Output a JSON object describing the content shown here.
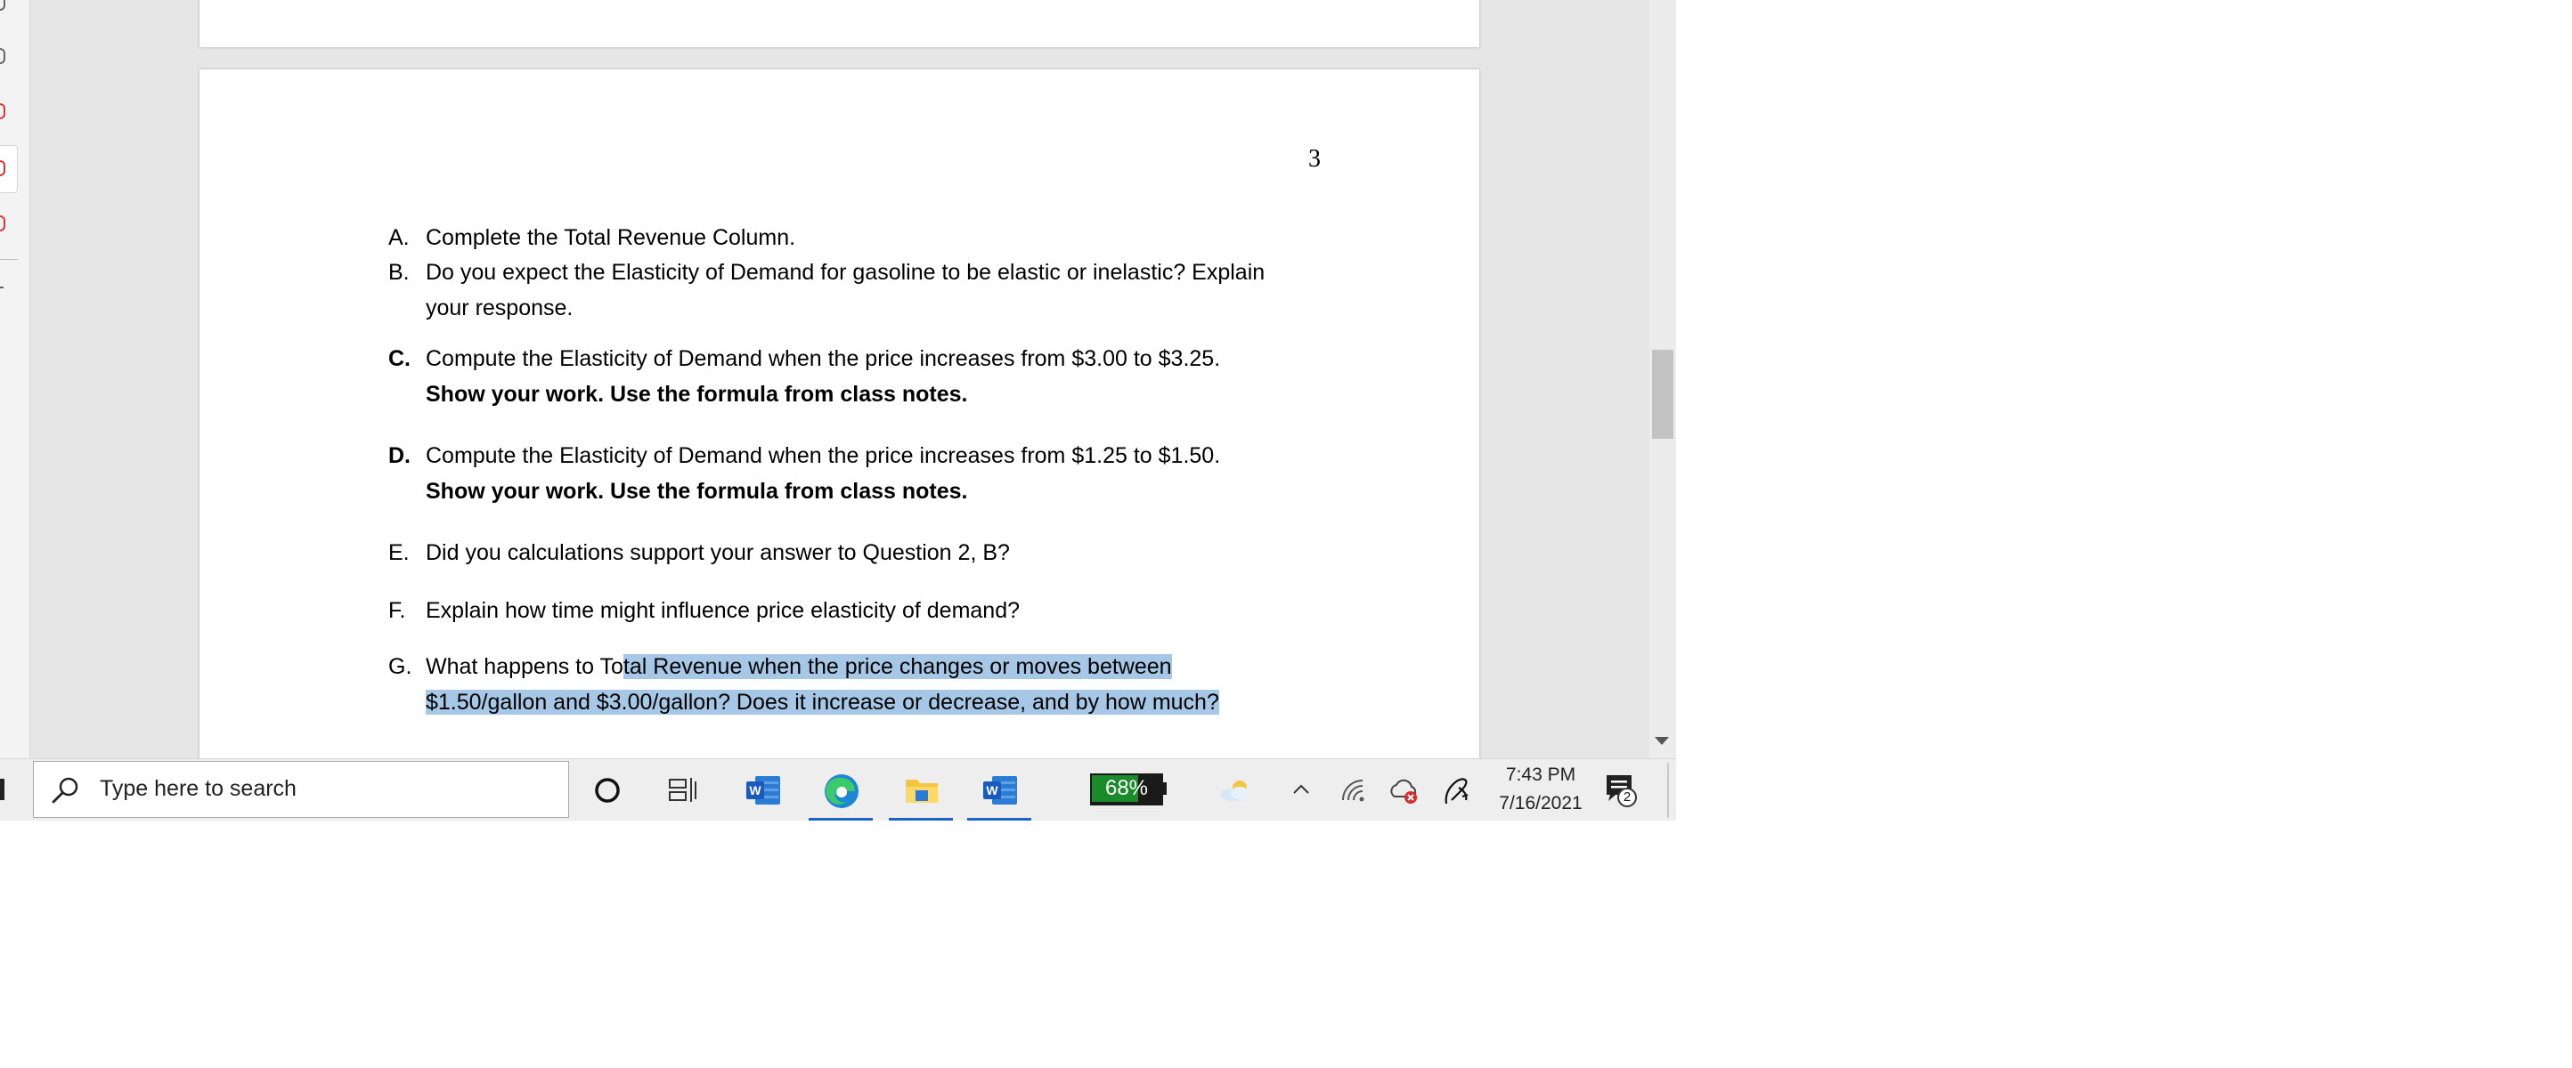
{
  "document": {
    "page_number": "3",
    "questions": [
      {
        "letter": "A.",
        "letter_bold": false,
        "lines": [
          "Complete the Total Revenue Column."
        ]
      },
      {
        "letter": "B.",
        "letter_bold": false,
        "lines": [
          "Do you expect the Elasticity of Demand for gasoline to be elastic or inelastic? Explain",
          "your response."
        ]
      },
      {
        "letter": "C.",
        "letter_bold": true,
        "lines": [
          "Compute the Elasticity of Demand when the price increases from $3.00 to $3.25.",
          "Show your work.  Use the formula from class notes."
        ]
      },
      {
        "letter": "D.",
        "letter_bold": true,
        "lines": [
          "Compute the Elasticity of Demand when the price increases from $1.25 to $1.50.",
          "Show your work.  Use the formula from class notes."
        ]
      },
      {
        "letter": "E.",
        "letter_bold": false,
        "lines": [
          "Did you calculations support your answer to Question 2, B?"
        ]
      },
      {
        "letter": "F.",
        "letter_bold": false,
        "lines": [
          "Explain how time might influence price elasticity of demand?"
        ]
      },
      {
        "letter": "G.",
        "letter_bold": false,
        "line1_plain": "What happens to To",
        "line1_highlighted": "tal Revenue when the price changes or moves between ",
        "line2_highlighted": "$1.50/gallon and $3.00/gallon?  Does it increase or decrease, and by how much?"
      }
    ],
    "highlight_color": "#a6c8e6"
  },
  "taskbar": {
    "search_placeholder": "Type here to search",
    "battery_percent": "68%",
    "battery_level": 0.68,
    "time": "7:43 PM",
    "date": "7/16/2021",
    "notification_count": "2",
    "icons": [
      "search-icon",
      "cortana-icon",
      "task-view-icon",
      "word-icon",
      "edge-icon",
      "file-explorer-icon",
      "word-icon",
      "battery-icon",
      "weather-icon",
      "chevron-up-icon",
      "wifi-icon",
      "cloud-sync-error-icon",
      "pen-icon",
      "action-center-icon"
    ],
    "accent_color": "#1e63c8"
  }
}
